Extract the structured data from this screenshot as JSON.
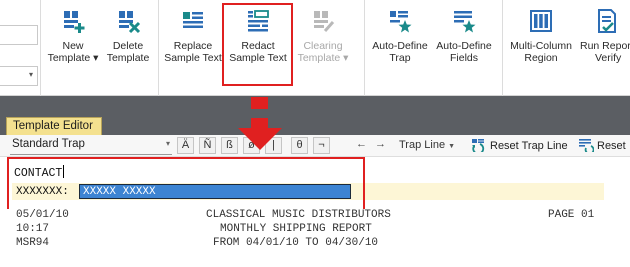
{
  "ribbon": {
    "buttons": [
      {
        "label_1": "New",
        "label_2": "Template ▾",
        "icon": "new-template-icon",
        "enabled": true
      },
      {
        "label_1": "Delete",
        "label_2": "Template",
        "icon": "delete-template-icon",
        "enabled": true
      },
      {
        "label_1": "Replace",
        "label_2": "Sample Text",
        "icon": "replace-sample-text-icon",
        "enabled": true
      },
      {
        "label_1": "Redact",
        "label_2": "Sample Text",
        "icon": "redact-sample-text-icon",
        "enabled": true
      },
      {
        "label_1": "Clearing",
        "label_2": "Template ▾",
        "icon": "clearing-template-icon",
        "enabled": false
      },
      {
        "label_1": "Auto-Define",
        "label_2": "Trap",
        "icon": "auto-define-trap-icon",
        "enabled": true
      },
      {
        "label_1": "Auto-Define",
        "label_2": "Fields",
        "icon": "auto-define-fields-icon",
        "enabled": true
      },
      {
        "label_1": "Multi-Column",
        "label_2": "Region",
        "icon": "multi-column-region-icon",
        "enabled": true
      },
      {
        "label_1": "Run Report",
        "label_2": "Verify",
        "icon": "run-report-verify-icon",
        "enabled": true
      }
    ]
  },
  "editor": {
    "tab_label": "Template Editor",
    "trap_type": "Standard Trap",
    "char_buttons": [
      "Ä",
      "Ñ",
      "ß",
      "ø",
      "|",
      "θ",
      "¬"
    ],
    "nav_left": "←",
    "nav_right": "→",
    "trap_line_label": "Trap Line",
    "reset_trap_line": "Reset Trap Line",
    "reset_other": "Reset",
    "trap_name": "CONTACT",
    "pattern_prefix": "XXXXXXX:",
    "pattern_selected": "XXXXX XXXXX"
  },
  "report": {
    "lines": [
      {
        "left": "05/01/10",
        "center": "CLASSICAL MUSIC DISTRIBUTORS",
        "right": "PAGE 01"
      },
      {
        "left": "10:17",
        "center": "MONTHLY SHIPPING REPORT",
        "right": ""
      },
      {
        "left": "MSR94",
        "center": "FROM 04/01/10 TO 04/30/10",
        "right": ""
      }
    ]
  },
  "colors": {
    "highlight_red": "#e02020",
    "tab_yellow": "#f4e18f",
    "selection_blue": "#3d84d2",
    "pattern_row": "#fdf6d6",
    "icon_blue": "#2d6db5",
    "icon_teal": "#1a8a8a"
  }
}
